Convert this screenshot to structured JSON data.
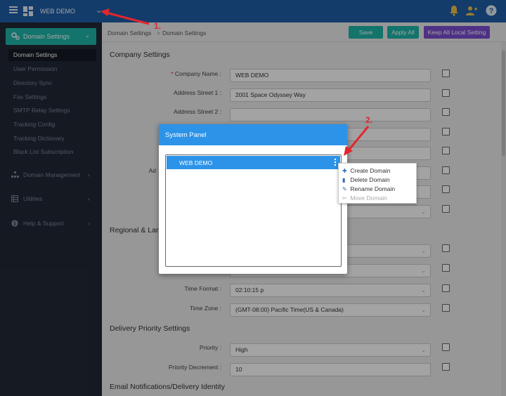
{
  "topbar": {
    "title": "WEB DEMO"
  },
  "sidebar": {
    "group": "Domain Settings",
    "items": [
      "Domain Settings",
      "User Permission",
      "Directory Sync",
      "Fax Settings",
      "SMTP Relay Settings",
      "Tracking Config",
      "Tracking Dictionary",
      "Black List Subscription"
    ],
    "sections": [
      "Domain Management",
      "Utilities",
      "Help & Support"
    ]
  },
  "breadcrumb": {
    "first": "Domain Settings",
    "sep": ">",
    "second": "Domain Settings"
  },
  "toolbar": {
    "save": "Save",
    "apply_all": "Apply All",
    "keep_all": "Keep All Local Setting"
  },
  "company": {
    "title": "Company Settings",
    "fields": [
      {
        "label": "Company Name :",
        "value": "WEB DEMO"
      },
      {
        "label": "Address Street 1 :",
        "value": "2001 Space Odyssey Way"
      },
      {
        "label": "Address Street 2 :",
        "value": ""
      }
    ],
    "partial_label": "Ad"
  },
  "regional": {
    "title": "Regional & Lan",
    "time_format_label": "Time Format :",
    "time_format": "02:10:15 p",
    "time_zone_label": "Time Zone :",
    "time_zone": "(GMT-08:00) Pacific Time(US & Canada)"
  },
  "delivery": {
    "title": "Delivery Priority Settings",
    "priority_label": "Priority :",
    "priority": "High",
    "decrement_label": "Priority Decrement :",
    "decrement": "10"
  },
  "email_section": {
    "title": "Email Notifications/Delivery Identity"
  },
  "modal": {
    "title": "System Panel",
    "node": "WEB DEMO"
  },
  "context_menu": {
    "create": "Create Domain",
    "delete": "Delete Domain",
    "rename": "Rename Domain",
    "move": "Move Domain"
  },
  "annotations": {
    "one": "1.",
    "two": "2."
  },
  "colors": {
    "header": "#1f5fa8",
    "accent": "#1fb6aa",
    "modal_blue": "#2c93e8",
    "keep_btn": "#7b4ed0",
    "annotation": "#e2262e"
  }
}
